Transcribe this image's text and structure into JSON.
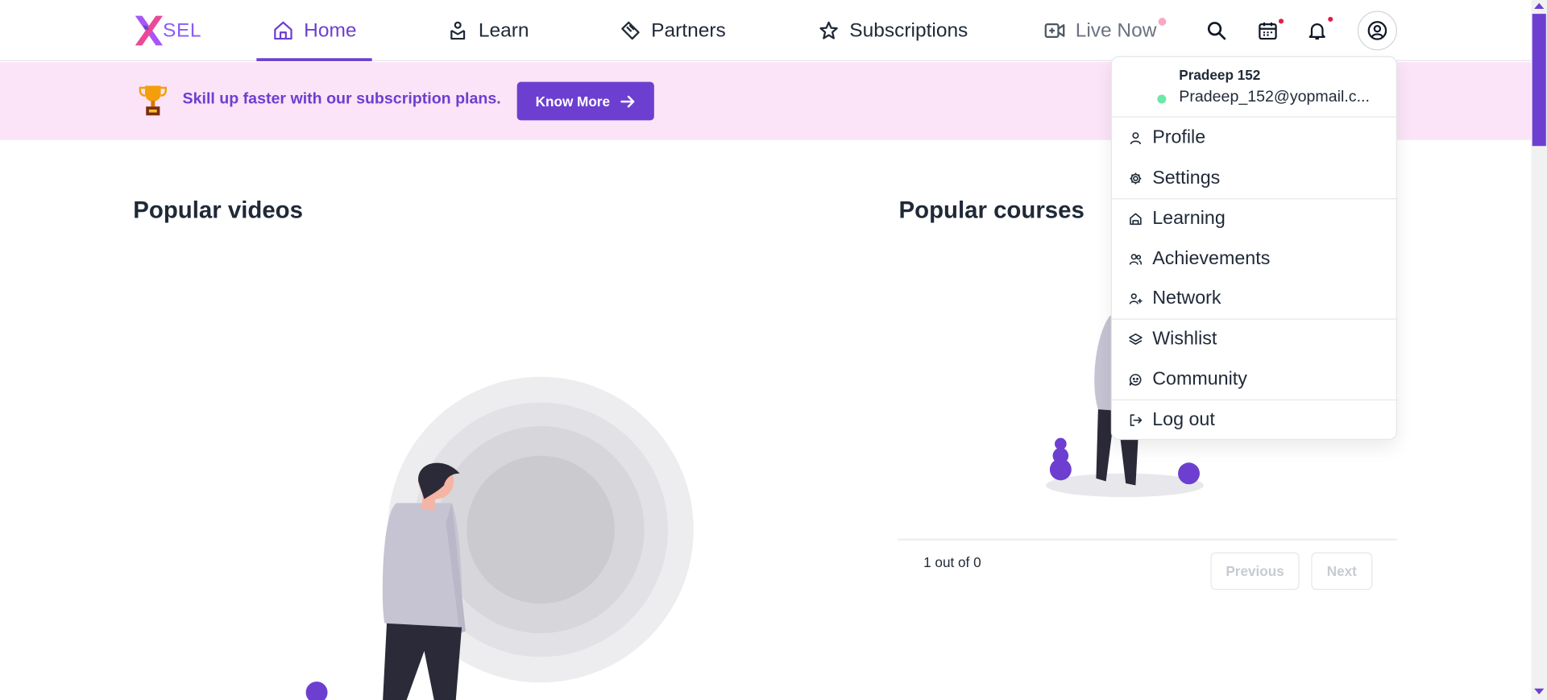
{
  "brand": {
    "name": "SEL",
    "accent": "#6d3fd0"
  },
  "nav": {
    "items": [
      {
        "label": "Home",
        "icon": "home-icon",
        "active": true
      },
      {
        "label": "Learn",
        "icon": "learn-icon"
      },
      {
        "label": "Partners",
        "icon": "handshake-icon"
      },
      {
        "label": "Subscriptions",
        "icon": "star-icon"
      },
      {
        "label": "Live Now",
        "icon": "video-icon"
      }
    ],
    "icons": [
      "search-icon",
      "calendar-icon",
      "bell-icon",
      "user-circle-icon"
    ]
  },
  "banner": {
    "text": "Skill up faster with our subscription plans.",
    "button": "Know More",
    "background": "#fbe4f7"
  },
  "sections": {
    "videos_title": "Popular videos",
    "courses_title": "Popular courses"
  },
  "pagination": {
    "count_text": "1 out of 0",
    "previous": "Previous",
    "next": "Next"
  },
  "user_menu": {
    "name": "Pradeep 152",
    "email": "Pradeep_152@yopmail.c...",
    "items": [
      {
        "label": "Profile",
        "icon": "user-icon"
      },
      {
        "label": "Settings",
        "icon": "gear-icon"
      },
      {
        "label": "Learning",
        "icon": "learning-icon"
      },
      {
        "label": "Achievements",
        "icon": "users-icon"
      },
      {
        "label": "Network",
        "icon": "user-plus-icon"
      },
      {
        "label": "Wishlist",
        "icon": "layers-icon"
      },
      {
        "label": "Community",
        "icon": "chat-icon"
      },
      {
        "label": "Log out",
        "icon": "logout-icon"
      }
    ]
  }
}
